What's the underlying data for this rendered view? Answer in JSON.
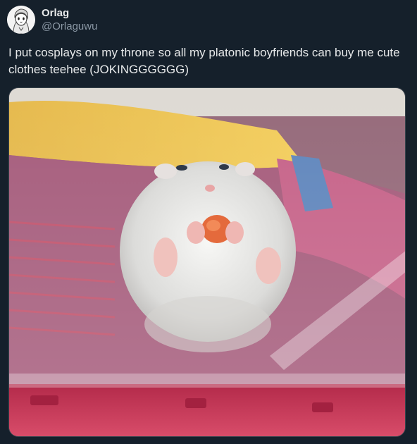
{
  "user": {
    "display_name": "Orlag",
    "handle": "@Orlaguwu"
  },
  "tweet": {
    "text": "I put cosplays on my throne so all my platonic boyfriends can buy me cute clothes teehee (JOKINGGGGGG)"
  },
  "media": {
    "subject": "white hamster eating a treat, seen from below through clear plastic"
  },
  "colors": {
    "background": "#15202b",
    "primary_text": "#e7e9ea",
    "secondary_text": "#8b98a5"
  }
}
